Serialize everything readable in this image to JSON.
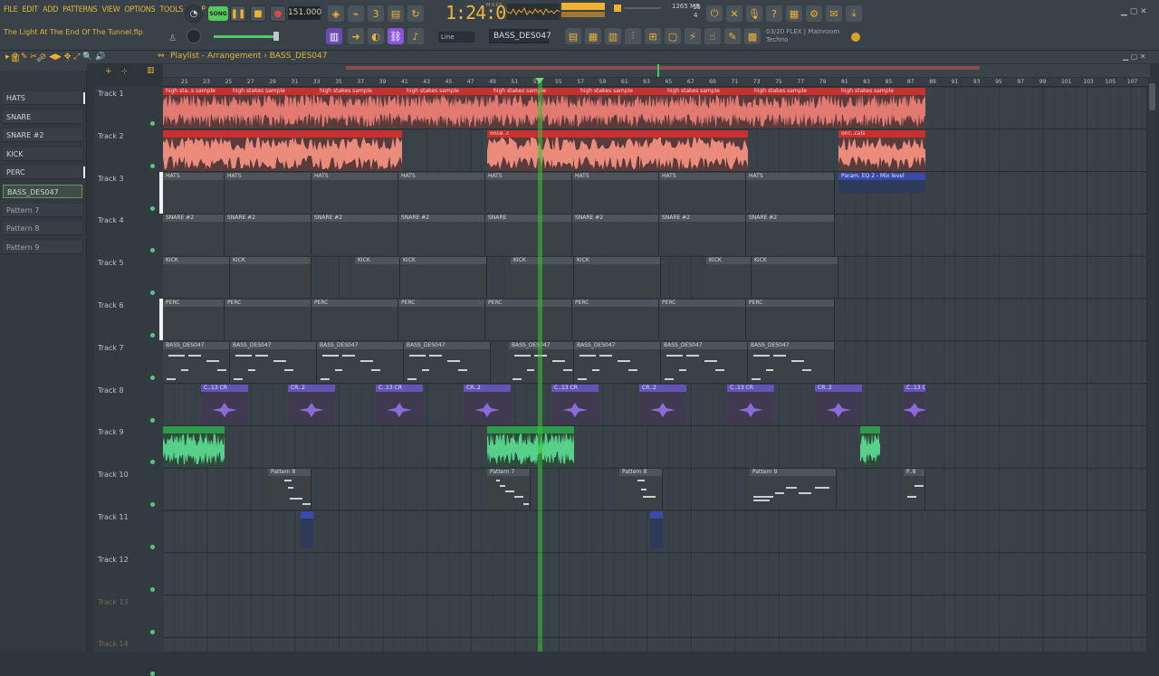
{
  "menu": [
    "FILE",
    "EDIT",
    "ADD",
    "PATTERNS",
    "VIEW",
    "OPTIONS",
    "TOOLS",
    "HELP"
  ],
  "project_file": "The Light At The End Of The Tunnel.flp",
  "transport": {
    "song_label": "SONG",
    "tempo": "151.000",
    "time": "1:24:09",
    "time_unit": "M:S:CS",
    "cpu_value": "15",
    "memory": "1265 MB",
    "memory_sub": "4"
  },
  "pattern_selector": "BASS_DES047",
  "snap": "Line",
  "hint": {
    "line1": "03/20 FLEX | Mainroom",
    "line2": "Techno"
  },
  "playlist": {
    "title": "Playlist - Arrangement",
    "crumb": "BASS_DES047"
  },
  "channels": [
    {
      "name": "HATS",
      "marked": true
    },
    {
      "name": "SNARE",
      "marked": false
    },
    {
      "name": "SNARE #2",
      "marked": false
    },
    {
      "name": "KICK",
      "marked": false
    },
    {
      "name": "PERC",
      "marked": true
    },
    {
      "name": "BASS_DES047",
      "marked": false,
      "selected": true
    },
    {
      "name": "Pattern 7",
      "marked": false
    },
    {
      "name": "Pattern 8",
      "marked": false
    },
    {
      "name": "Pattern 9",
      "marked": false
    }
  ],
  "ruler": [
    "21",
    "23",
    "25",
    "27",
    "29",
    "31",
    "33",
    "35",
    "37",
    "39",
    "41",
    "43",
    "45",
    "47",
    "49",
    "51",
    "53",
    "55",
    "57",
    "59",
    "61",
    "63",
    "65",
    "67",
    "69",
    "71",
    "73",
    "75",
    "77",
    "79",
    "81",
    "83",
    "85",
    "87",
    "89",
    "91",
    "93",
    "95",
    "97",
    "99",
    "101",
    "103",
    "105",
    "107"
  ],
  "tracks": [
    {
      "label": "Track 1"
    },
    {
      "label": "Track 2"
    },
    {
      "label": "Track 3"
    },
    {
      "label": "Track 4"
    },
    {
      "label": "Track 5"
    },
    {
      "label": "Track 6"
    },
    {
      "label": "Track 7"
    },
    {
      "label": "Track 8"
    },
    {
      "label": "Track 9"
    },
    {
      "label": "Track 10"
    },
    {
      "label": "Track 11"
    },
    {
      "label": "Track 12"
    },
    {
      "label": "Track 13"
    },
    {
      "label": "Track 14"
    }
  ],
  "clip_names": {
    "high": "high stakes sample",
    "high_short": "high sta..s sample",
    "once": "once..cals",
    "once_short": "onc..cals",
    "hats": "HATS",
    "snare2": "SNARE #2",
    "snare": "SNARE",
    "kick": "KICK",
    "perc": "PERC",
    "bass": "BASS_DES047",
    "auto": "Param. EQ 2 - Mix level",
    "purple_a": "C..13",
    "purple_b": "CR..2",
    "purple_c": "CR",
    "p8": "Pattern 8",
    "p7": "Pattern 7",
    "p9": "Pattern 9",
    "p_short": "P..8"
  },
  "colors": {
    "accent": "#f0b030",
    "audio": "#c83030",
    "playhead": "#32c832",
    "green_clip": "#2f9a4a",
    "purple_clip": "#6454b8"
  }
}
